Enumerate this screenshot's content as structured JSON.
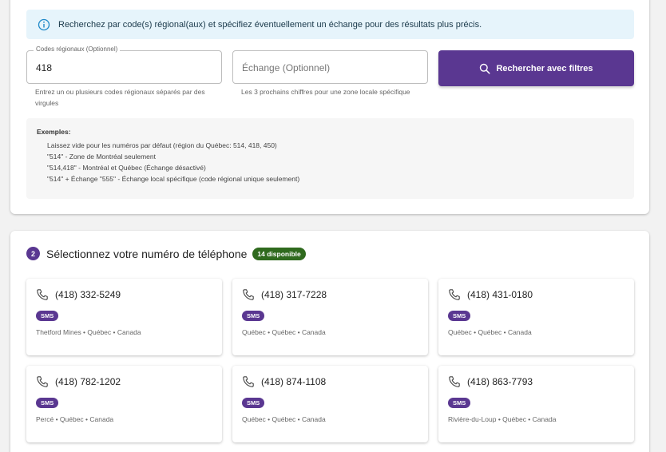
{
  "search": {
    "info_text": "Recherchez par code(s) régional(aux) et spécifiez éventuellement un échange pour des résultats plus précis.",
    "codes_label": "Codes régionaux (Optionnel)",
    "codes_value": "418",
    "codes_helper": "Entrez un ou plusieurs codes régionaux séparés par des virgules",
    "exchange_placeholder": "Échange (Optionnel)",
    "exchange_helper": "Les 3 prochains chiffres pour une zone locale spécifique",
    "button_label": "Rechercher avec filtres",
    "examples_title": "Exemples:",
    "examples": [
      "Laissez vide pour les numéros par défaut (région du Québec: 514, 418, 450)",
      "\"514\" - Zone de Montréal seulement",
      "\"514,418\" - Montréal et Québec (Échange désactivé)",
      "\"514\" + Échange \"555\" - Échange local spécifique (code régional unique seulement)"
    ]
  },
  "results": {
    "step": "2",
    "title": "Sélectionnez votre numéro de téléphone",
    "badge": "14 disponible",
    "numbers": [
      {
        "number": "(418) 332-5249",
        "tag": "SMS",
        "location": "Thetford Mines • Québec • Canada"
      },
      {
        "number": "(418) 317-7228",
        "tag": "SMS",
        "location": "Québec • Québec • Canada"
      },
      {
        "number": "(418) 431-0180",
        "tag": "SMS",
        "location": "Québec • Québec • Canada"
      },
      {
        "number": "(418) 782-1202",
        "tag": "SMS",
        "location": "Percé • Québec • Canada"
      },
      {
        "number": "(418) 874-1108",
        "tag": "SMS",
        "location": "Québec • Québec • Canada"
      },
      {
        "number": "(418) 863-7793",
        "tag": "SMS",
        "location": "Rivière-du-Loup • Québec • Canada"
      }
    ]
  },
  "colors": {
    "primary": "#5a3791",
    "info_bg": "#e6f4fb",
    "info_icon": "#1e88c8",
    "badge_green": "#2f6a1e"
  },
  "icons": {
    "info": "info-circle-icon",
    "search": "search-icon",
    "phone": "phone-icon"
  }
}
